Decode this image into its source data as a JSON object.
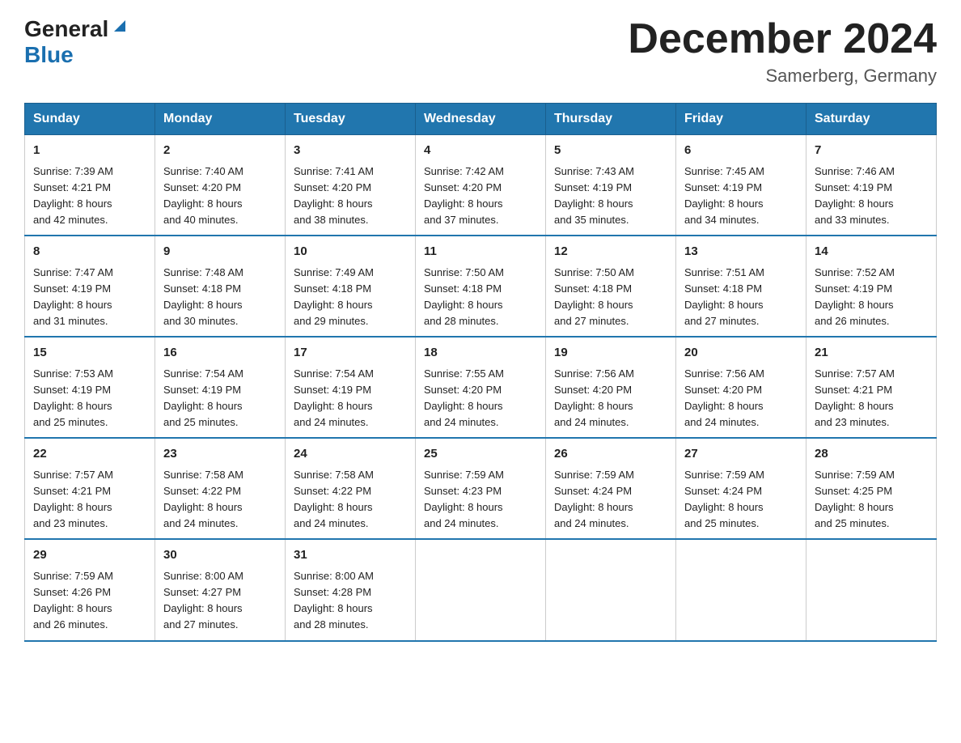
{
  "header": {
    "logo_line1": "General",
    "logo_line2": "Blue",
    "month_title": "December 2024",
    "location": "Samerberg, Germany"
  },
  "weekdays": [
    "Sunday",
    "Monday",
    "Tuesday",
    "Wednesday",
    "Thursday",
    "Friday",
    "Saturday"
  ],
  "weeks": [
    [
      {
        "day": "1",
        "sunrise": "Sunrise: 7:39 AM",
        "sunset": "Sunset: 4:21 PM",
        "daylight": "Daylight: 8 hours",
        "daylight2": "and 42 minutes."
      },
      {
        "day": "2",
        "sunrise": "Sunrise: 7:40 AM",
        "sunset": "Sunset: 4:20 PM",
        "daylight": "Daylight: 8 hours",
        "daylight2": "and 40 minutes."
      },
      {
        "day": "3",
        "sunrise": "Sunrise: 7:41 AM",
        "sunset": "Sunset: 4:20 PM",
        "daylight": "Daylight: 8 hours",
        "daylight2": "and 38 minutes."
      },
      {
        "day": "4",
        "sunrise": "Sunrise: 7:42 AM",
        "sunset": "Sunset: 4:20 PM",
        "daylight": "Daylight: 8 hours",
        "daylight2": "and 37 minutes."
      },
      {
        "day": "5",
        "sunrise": "Sunrise: 7:43 AM",
        "sunset": "Sunset: 4:19 PM",
        "daylight": "Daylight: 8 hours",
        "daylight2": "and 35 minutes."
      },
      {
        "day": "6",
        "sunrise": "Sunrise: 7:45 AM",
        "sunset": "Sunset: 4:19 PM",
        "daylight": "Daylight: 8 hours",
        "daylight2": "and 34 minutes."
      },
      {
        "day": "7",
        "sunrise": "Sunrise: 7:46 AM",
        "sunset": "Sunset: 4:19 PM",
        "daylight": "Daylight: 8 hours",
        "daylight2": "and 33 minutes."
      }
    ],
    [
      {
        "day": "8",
        "sunrise": "Sunrise: 7:47 AM",
        "sunset": "Sunset: 4:19 PM",
        "daylight": "Daylight: 8 hours",
        "daylight2": "and 31 minutes."
      },
      {
        "day": "9",
        "sunrise": "Sunrise: 7:48 AM",
        "sunset": "Sunset: 4:18 PM",
        "daylight": "Daylight: 8 hours",
        "daylight2": "and 30 minutes."
      },
      {
        "day": "10",
        "sunrise": "Sunrise: 7:49 AM",
        "sunset": "Sunset: 4:18 PM",
        "daylight": "Daylight: 8 hours",
        "daylight2": "and 29 minutes."
      },
      {
        "day": "11",
        "sunrise": "Sunrise: 7:50 AM",
        "sunset": "Sunset: 4:18 PM",
        "daylight": "Daylight: 8 hours",
        "daylight2": "and 28 minutes."
      },
      {
        "day": "12",
        "sunrise": "Sunrise: 7:50 AM",
        "sunset": "Sunset: 4:18 PM",
        "daylight": "Daylight: 8 hours",
        "daylight2": "and 27 minutes."
      },
      {
        "day": "13",
        "sunrise": "Sunrise: 7:51 AM",
        "sunset": "Sunset: 4:18 PM",
        "daylight": "Daylight: 8 hours",
        "daylight2": "and 27 minutes."
      },
      {
        "day": "14",
        "sunrise": "Sunrise: 7:52 AM",
        "sunset": "Sunset: 4:19 PM",
        "daylight": "Daylight: 8 hours",
        "daylight2": "and 26 minutes."
      }
    ],
    [
      {
        "day": "15",
        "sunrise": "Sunrise: 7:53 AM",
        "sunset": "Sunset: 4:19 PM",
        "daylight": "Daylight: 8 hours",
        "daylight2": "and 25 minutes."
      },
      {
        "day": "16",
        "sunrise": "Sunrise: 7:54 AM",
        "sunset": "Sunset: 4:19 PM",
        "daylight": "Daylight: 8 hours",
        "daylight2": "and 25 minutes."
      },
      {
        "day": "17",
        "sunrise": "Sunrise: 7:54 AM",
        "sunset": "Sunset: 4:19 PM",
        "daylight": "Daylight: 8 hours",
        "daylight2": "and 24 minutes."
      },
      {
        "day": "18",
        "sunrise": "Sunrise: 7:55 AM",
        "sunset": "Sunset: 4:20 PM",
        "daylight": "Daylight: 8 hours",
        "daylight2": "and 24 minutes."
      },
      {
        "day": "19",
        "sunrise": "Sunrise: 7:56 AM",
        "sunset": "Sunset: 4:20 PM",
        "daylight": "Daylight: 8 hours",
        "daylight2": "and 24 minutes."
      },
      {
        "day": "20",
        "sunrise": "Sunrise: 7:56 AM",
        "sunset": "Sunset: 4:20 PM",
        "daylight": "Daylight: 8 hours",
        "daylight2": "and 24 minutes."
      },
      {
        "day": "21",
        "sunrise": "Sunrise: 7:57 AM",
        "sunset": "Sunset: 4:21 PM",
        "daylight": "Daylight: 8 hours",
        "daylight2": "and 23 minutes."
      }
    ],
    [
      {
        "day": "22",
        "sunrise": "Sunrise: 7:57 AM",
        "sunset": "Sunset: 4:21 PM",
        "daylight": "Daylight: 8 hours",
        "daylight2": "and 23 minutes."
      },
      {
        "day": "23",
        "sunrise": "Sunrise: 7:58 AM",
        "sunset": "Sunset: 4:22 PM",
        "daylight": "Daylight: 8 hours",
        "daylight2": "and 24 minutes."
      },
      {
        "day": "24",
        "sunrise": "Sunrise: 7:58 AM",
        "sunset": "Sunset: 4:22 PM",
        "daylight": "Daylight: 8 hours",
        "daylight2": "and 24 minutes."
      },
      {
        "day": "25",
        "sunrise": "Sunrise: 7:59 AM",
        "sunset": "Sunset: 4:23 PM",
        "daylight": "Daylight: 8 hours",
        "daylight2": "and 24 minutes."
      },
      {
        "day": "26",
        "sunrise": "Sunrise: 7:59 AM",
        "sunset": "Sunset: 4:24 PM",
        "daylight": "Daylight: 8 hours",
        "daylight2": "and 24 minutes."
      },
      {
        "day": "27",
        "sunrise": "Sunrise: 7:59 AM",
        "sunset": "Sunset: 4:24 PM",
        "daylight": "Daylight: 8 hours",
        "daylight2": "and 25 minutes."
      },
      {
        "day": "28",
        "sunrise": "Sunrise: 7:59 AM",
        "sunset": "Sunset: 4:25 PM",
        "daylight": "Daylight: 8 hours",
        "daylight2": "and 25 minutes."
      }
    ],
    [
      {
        "day": "29",
        "sunrise": "Sunrise: 7:59 AM",
        "sunset": "Sunset: 4:26 PM",
        "daylight": "Daylight: 8 hours",
        "daylight2": "and 26 minutes."
      },
      {
        "day": "30",
        "sunrise": "Sunrise: 8:00 AM",
        "sunset": "Sunset: 4:27 PM",
        "daylight": "Daylight: 8 hours",
        "daylight2": "and 27 minutes."
      },
      {
        "day": "31",
        "sunrise": "Sunrise: 8:00 AM",
        "sunset": "Sunset: 4:28 PM",
        "daylight": "Daylight: 8 hours",
        "daylight2": "and 28 minutes."
      },
      null,
      null,
      null,
      null
    ]
  ]
}
